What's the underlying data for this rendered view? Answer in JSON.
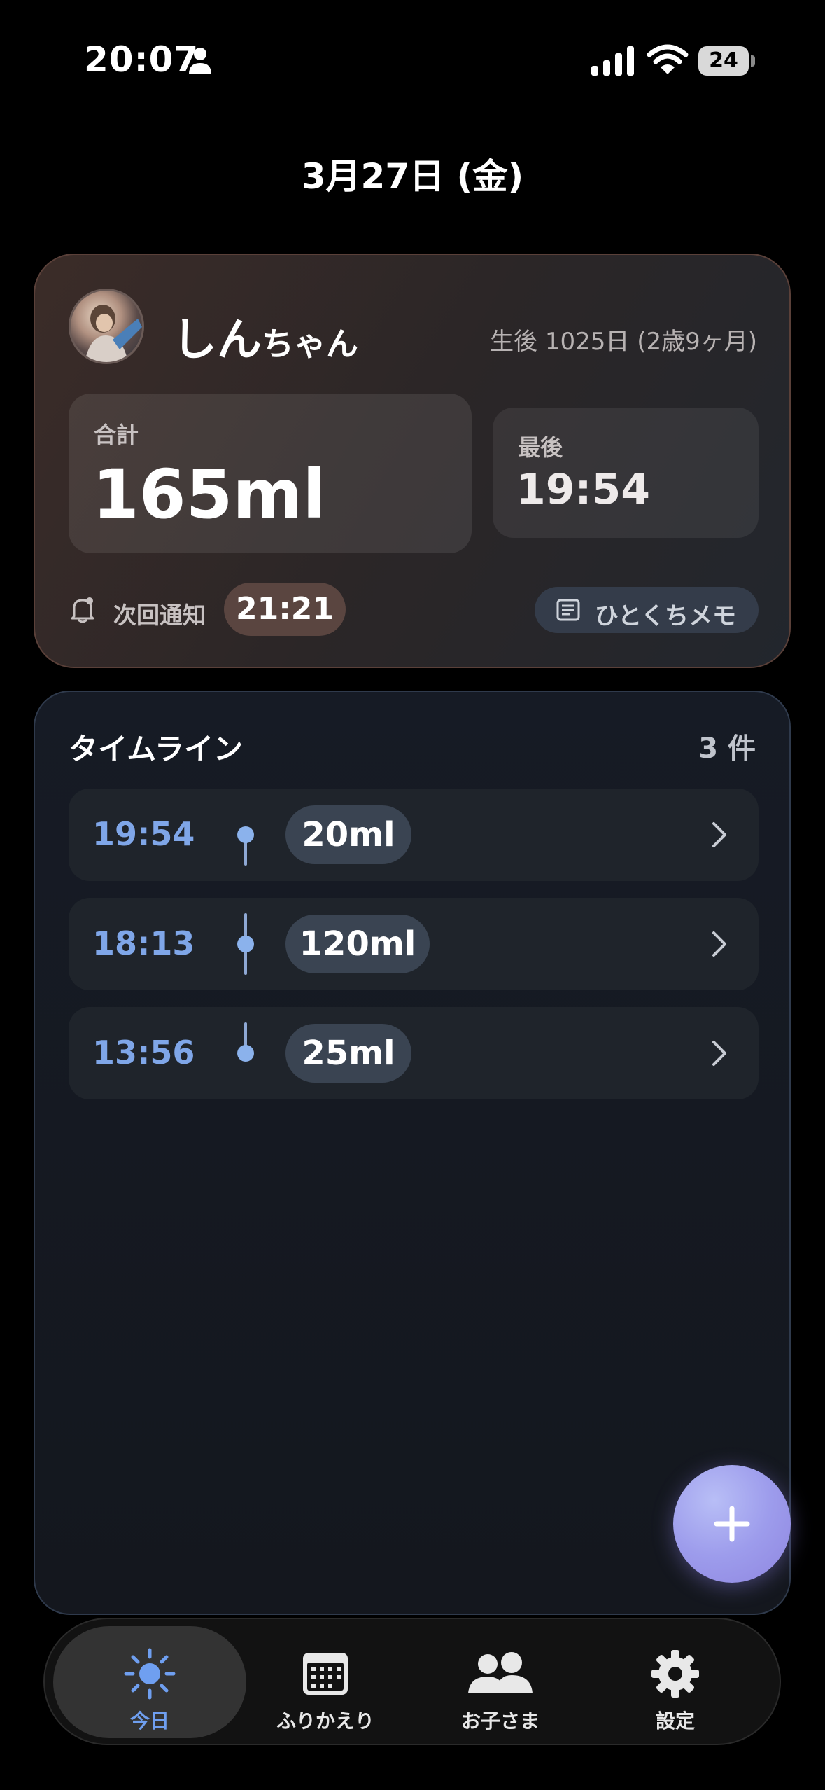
{
  "status_bar": {
    "time": "20:07",
    "battery": "24"
  },
  "header": {
    "date": "3月27日 (金)"
  },
  "summary": {
    "child_name": "しん",
    "child_suffix": "ちゃん",
    "age": "生後 1025日 (2歳9ヶ月)",
    "total_label": "合計",
    "total_value": "165ml",
    "last_label": "最後",
    "last_value": "19:54",
    "notify_label": "次回通知",
    "notify_time": "21:21",
    "memo_label": "ひとくちメモ"
  },
  "timeline": {
    "title": "タイムライン",
    "count": "3 件",
    "entries": [
      {
        "time": "19:54",
        "amount": "20ml"
      },
      {
        "time": "18:13",
        "amount": "120ml"
      },
      {
        "time": "13:56",
        "amount": "25ml"
      }
    ]
  },
  "tabs": [
    {
      "label": "今日",
      "icon": "sun-icon",
      "active": true
    },
    {
      "label": "ふりかえり",
      "icon": "calendar-icon",
      "active": false
    },
    {
      "label": "お子さま",
      "icon": "people-icon",
      "active": false
    },
    {
      "label": "設定",
      "icon": "gear-icon",
      "active": false
    }
  ],
  "colors": {
    "accent": "#6f9ff0",
    "fab": "#9d9cec",
    "notify_pill": "#5a4540"
  }
}
